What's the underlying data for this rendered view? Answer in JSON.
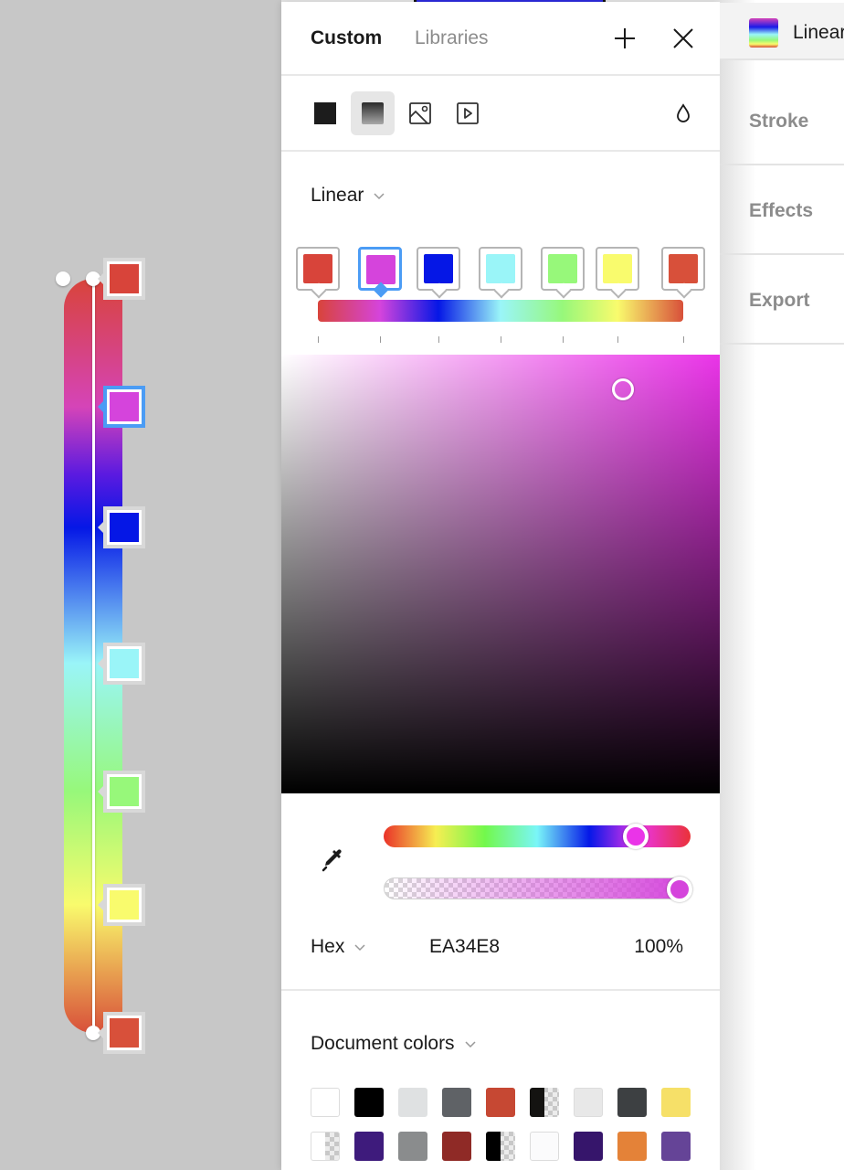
{
  "canvas": {
    "gradient_stops": [
      {
        "color": "#d8443a",
        "position": 0.0
      },
      {
        "color": "#d544dc",
        "position": 0.17
      },
      {
        "color": "#0517e6",
        "position": 0.33
      },
      {
        "color": "#9af5f8",
        "position": 0.51
      },
      {
        "color": "#97f87a",
        "position": 0.68
      },
      {
        "color": "#f9fb6d",
        "position": 0.83
      },
      {
        "color": "#d8503a",
        "position": 1.0
      }
    ],
    "selected_stop_index": 1
  },
  "picker": {
    "tabs": {
      "custom": "Custom",
      "libraries": "Libraries"
    },
    "header_icons": {
      "add": "plus-icon",
      "close": "close-icon"
    },
    "paint_types": [
      {
        "name": "solid-fill-icon",
        "active": false
      },
      {
        "name": "gradient-fill-icon",
        "active": true
      },
      {
        "name": "image-fill-icon",
        "active": false
      },
      {
        "name": "video-fill-icon",
        "active": false
      }
    ],
    "blend_icon": "drop-icon",
    "gradient_type": "Linear",
    "stops": [
      {
        "color": "#d8443a",
        "position": 0.0
      },
      {
        "color": "#d544dc",
        "position": 0.17
      },
      {
        "color": "#0517e6",
        "position": 0.33
      },
      {
        "color": "#9af5f8",
        "position": 0.5
      },
      {
        "color": "#97f87a",
        "position": 0.67
      },
      {
        "color": "#f9fb6d",
        "position": 0.82
      },
      {
        "color": "#d8503a",
        "position": 1.0
      }
    ],
    "selected_stop_index": 1,
    "current_hue_color": "#ea34e8",
    "saturation": 0.78,
    "brightness": 0.92,
    "hue_fraction": 0.82,
    "alpha_fraction": 1.0,
    "color_mode": "Hex",
    "hex_value": "EA34E8",
    "opacity": "100%",
    "document_colors_label": "Document colors",
    "document_colors": [
      {
        "color": "#ffffff",
        "type": "solid",
        "bordered": true
      },
      {
        "color": "#000000",
        "type": "solid"
      },
      {
        "color": "#dfe1e2",
        "type": "solid"
      },
      {
        "color": "#5f6266",
        "type": "solid"
      },
      {
        "color": "#c64833",
        "type": "solid"
      },
      {
        "color": "#141311",
        "type": "half-transparent"
      },
      {
        "color": "#e8e8e8",
        "type": "solid",
        "bordered": true
      },
      {
        "color": "#3d4042",
        "type": "solid"
      },
      {
        "color": "#f6e068",
        "type": "solid"
      },
      {
        "color": "#ffffff",
        "type": "half-transparent",
        "bordered": true
      },
      {
        "color": "#3e1b7c",
        "type": "solid"
      },
      {
        "color": "#8a8c8d",
        "type": "solid"
      },
      {
        "color": "#8f2a26",
        "type": "solid"
      },
      {
        "color": "#000000",
        "type": "half-transparent"
      },
      {
        "color": "#fbfbfc",
        "type": "solid",
        "bordered": true
      },
      {
        "color": "#36156b",
        "type": "solid"
      },
      {
        "color": "#e48238",
        "type": "solid"
      },
      {
        "color": "#654497",
        "type": "solid"
      }
    ]
  },
  "properties": {
    "fill_label": "Linear",
    "sections": [
      "Stroke",
      "Effects",
      "Export"
    ]
  }
}
